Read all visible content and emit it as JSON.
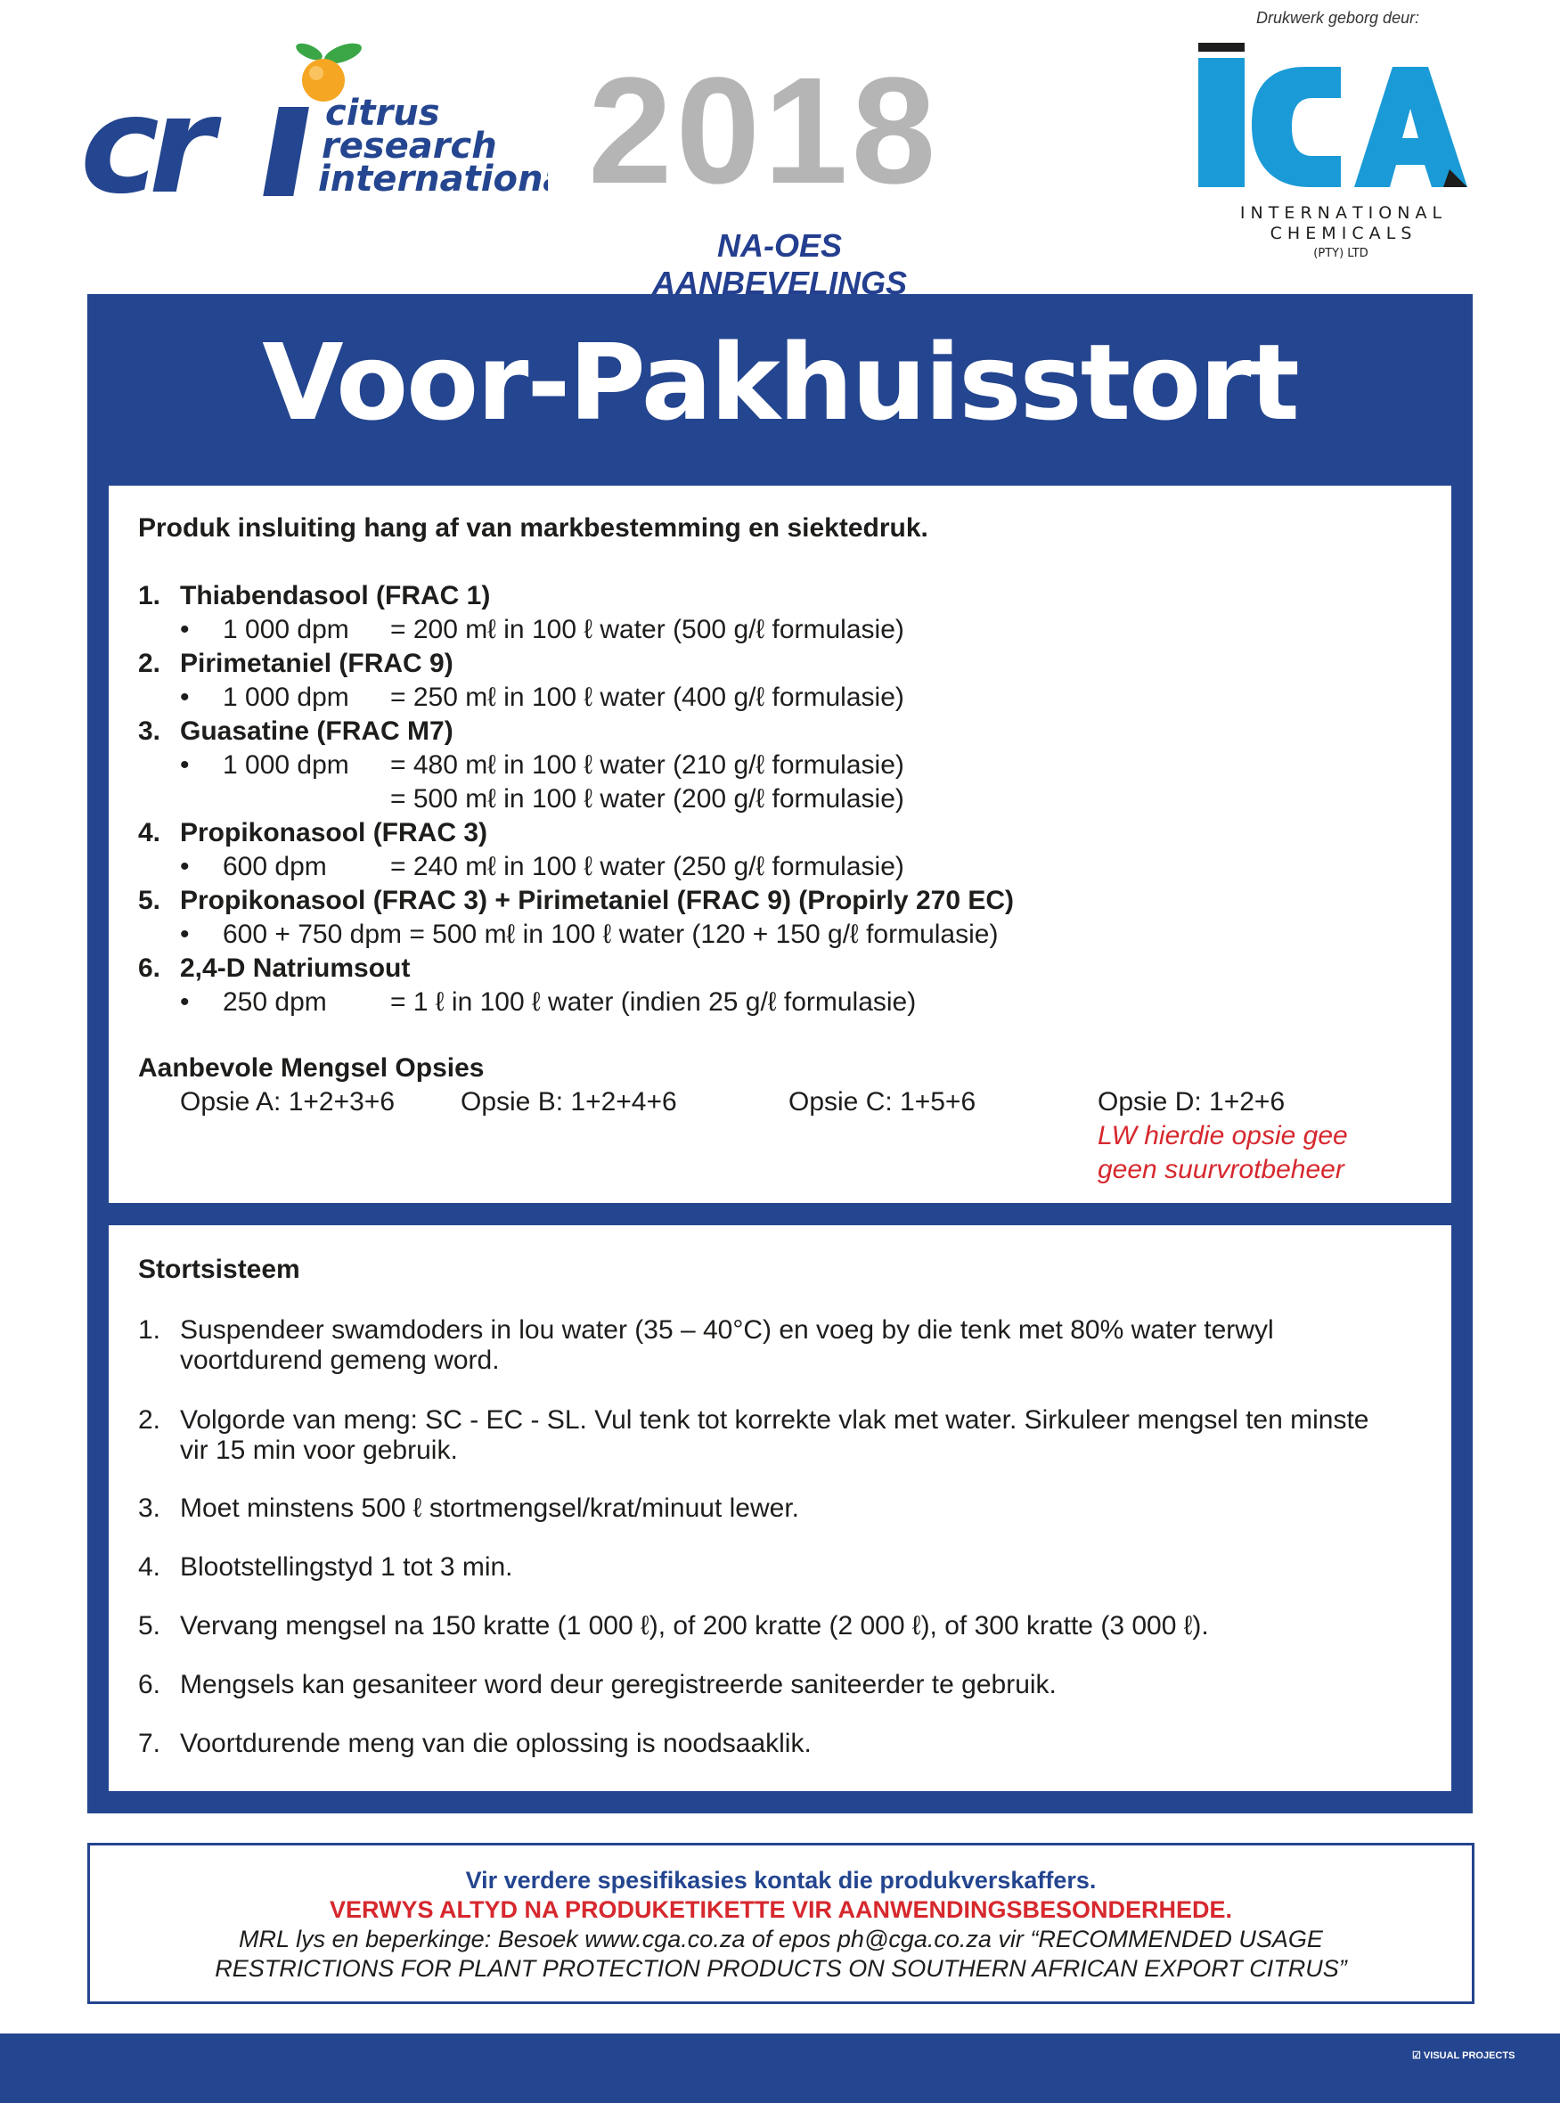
{
  "header": {
    "logo_left": {
      "icon": "cri-logo-icon",
      "mark": "cri",
      "lines": [
        "citrus",
        "research",
        "international"
      ]
    },
    "year": "2018",
    "subtitle": "NA-OES AANBEVELINGS",
    "printed_by": "Drukwerk geborg deur:",
    "logo_right": {
      "icon": "ica-logo-icon",
      "mark": "ICA",
      "line1": "I N T E R N A T I O N A L",
      "line2": "C H E M I C A L S",
      "line3": "(PTY) LTD"
    }
  },
  "title": "Voor-Pakhuisstort",
  "products": {
    "intro": "Produk insluiting hang af van markbestemming en siektedruk.",
    "items": [
      {
        "num": "1.",
        "name": "Thiabendasool (FRAC 1)",
        "rows": [
          {
            "bullet": "•",
            "dose": "1 000 dpm",
            "rate": "= 200 mℓ in 100 ℓ water (500 g/ℓ formulasie)"
          }
        ]
      },
      {
        "num": "2.",
        "name": "Pirimetaniel (FRAC 9)",
        "rows": [
          {
            "bullet": "•",
            "dose": "1 000 dpm",
            "rate": "= 250 mℓ in 100 ℓ water (400 g/ℓ formulasie)"
          }
        ]
      },
      {
        "num": "3.",
        "name": "Guasatine (FRAC M7)",
        "rows": [
          {
            "bullet": "•",
            "dose": "1 000 dpm",
            "rate": "= 480 mℓ in 100 ℓ water (210 g/ℓ formulasie)"
          },
          {
            "bullet": "",
            "dose": "",
            "rate": "= 500 mℓ in 100 ℓ water (200 g/ℓ formulasie)"
          }
        ]
      },
      {
        "num": "4.",
        "name": "Propikonasool (FRAC 3)",
        "rows": [
          {
            "bullet": "•",
            "dose": "600 dpm",
            "rate": "= 240 mℓ in 100 ℓ water (250 g/ℓ formulasie)"
          }
        ]
      },
      {
        "num": "5.",
        "name": "Propikonasool (FRAC 3) + Pirimetaniel (FRAC 9) (Propirly 270 EC)",
        "rows": [
          {
            "bullet": "•",
            "dose": "600 + 750 dpm = 500 mℓ in 100 ℓ water (120 + 150 g/ℓ formulasie)",
            "rate": ""
          }
        ]
      },
      {
        "num": "6.",
        "name": "2,4-D Natriumsout",
        "rows": [
          {
            "bullet": "•",
            "dose": "250 dpm",
            "rate": "= 1 ℓ in 100 ℓ water (indien 25 g/ℓ formulasie)"
          }
        ]
      }
    ],
    "mix_heading": "Aanbevole Mengsel Opsies",
    "options": [
      "Opsie A: 1+2+3+6",
      "Opsie B: 1+2+4+6",
      "Opsie C: 1+5+6",
      "Opsie D: 1+2+6"
    ],
    "option_note": [
      "LW hierdie opsie gee",
      "geen suurvrotbeheer"
    ]
  },
  "system": {
    "heading": "Stortsisteem",
    "steps": [
      {
        "num": "1.",
        "lines": [
          "Suspendeer swamdoders in lou water (35 – 40°C) en voeg by die tenk met 80% water terwyl",
          "voortdurend gemeng word."
        ]
      },
      {
        "num": "2.",
        "lines": [
          "Volgorde van meng: SC - EC - SL. Vul tenk tot korrekte vlak met water. Sirkuleer mengsel ten minste",
          "vir 15 min voor gebruik."
        ]
      },
      {
        "num": "3.",
        "lines": [
          "Moet minstens 500 ℓ stortmengsel/krat/minuut lewer."
        ]
      },
      {
        "num": "4.",
        "lines": [
          "Blootstellingstyd 1 tot 3 min."
        ]
      },
      {
        "num": "5.",
        "lines": [
          "Vervang mengsel na 150 kratte (1 000 ℓ), of 200 kratte (2 000 ℓ), of 300 kratte (3 000 ℓ)."
        ]
      },
      {
        "num": "6.",
        "lines": [
          "Mengsels kan gesaniteer word deur geregistreerde saniteerder te gebruik."
        ]
      },
      {
        "num": "7.",
        "lines": [
          "Voortdurende meng van die oplossing is noodsaaklik."
        ]
      }
    ]
  },
  "footer": {
    "line1": "Vir verdere spesifikasies kontak die produkverskaffers.",
    "line2": "VERWYS ALTYD NA PRODUKETIKETTE VIR AANWENDINGSBESONDERHEDE.",
    "line3": "MRL lys en beperkinge: Besoek www.cga.co.za of epos ph@cga.co.za vir “RECOMMENDED USAGE",
    "line4": "RESTRICTIONS FOR PLANT PROTECTION PRODUCTS ON SOUTHERN AFRICAN EXPORT CITRUS”",
    "credit": "VISUAL PROJECTS"
  },
  "colors": {
    "brand_blue": "#24458f",
    "grey_year": "#b5b5b5",
    "warning_red": "#d6282e",
    "ica_cyan": "#1a9ad6",
    "orange": "#f5a623",
    "leaf_green": "#3aa646"
  }
}
